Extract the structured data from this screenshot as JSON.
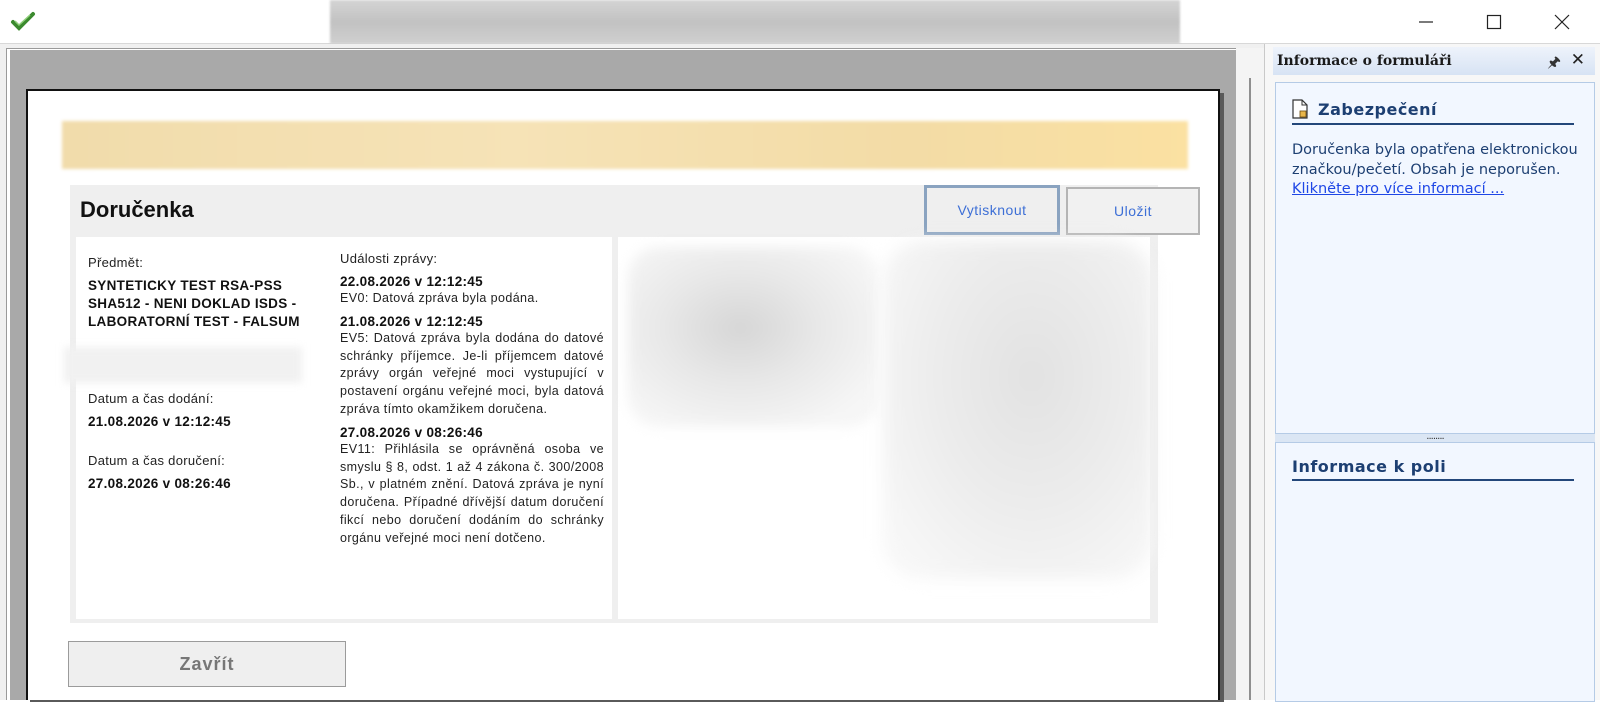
{
  "window": {
    "controls": {
      "minimize": "—",
      "maximize": "☐",
      "close": "✕"
    }
  },
  "form": {
    "title": "Doručenka",
    "buttons": {
      "print": "Vytisknout",
      "save": "Uložit",
      "close": "Zavřít"
    },
    "subject_label": "Předmět:",
    "subject_value": "SYNTETICKY TEST RSA-PSS SHA512 - NENI DOKLAD ISDS - LABORATORNÍ TEST - FALSUM",
    "delivered_label": "Datum a čas dodání:",
    "delivered_value": "21.08.2026 v 12:12:45",
    "received_label": "Datum a čas doručení:",
    "received_value": "27.08.2026 v 08:26:46",
    "events_label": "Události zprávy:",
    "events": [
      {
        "date": "22.08.2026 v 12:12:45",
        "text": "EV0: Datová zpráva byla podána."
      },
      {
        "date": "21.08.2026 v 12:12:45",
        "text": "EV5: Datová zpráva byla dodána do datové schránky příjemce. Je-li příjemcem datové zprávy orgán veřejné moci vystupující v postavení orgánu veřejné moci, byla datová zpráva tímto okamžikem doručena."
      },
      {
        "date": "27.08.2026 v 08:26:46",
        "text": "EV11: Přihlásila se oprávněná osoba ve smyslu § 8, odst. 1 až 4 zákona č. 300/2008 Sb., v platném znění. Datová zpráva je nyní doručena. Případné dřívější datum doručení fikcí nebo doručení dodáním do schránky orgánu veřejné moci není dotčeno."
      }
    ]
  },
  "info_pane": {
    "title": "Informace o formuláři",
    "pin": "🖈",
    "close": "✕",
    "security_heading": "Zabezpečení",
    "security_text": "Doručenka byla opatřena elektronickou značkou/pečetí. Obsah je neporušen.",
    "security_link": "Klikněte pro více informací ...",
    "splitter_grip": "........",
    "field_info_heading": "Informace k poli"
  },
  "colors": {
    "accent_blue": "#1d3f72",
    "link_blue": "#1f47e6",
    "button_text": "#3d6fd6",
    "banner": "#f3dca6"
  }
}
